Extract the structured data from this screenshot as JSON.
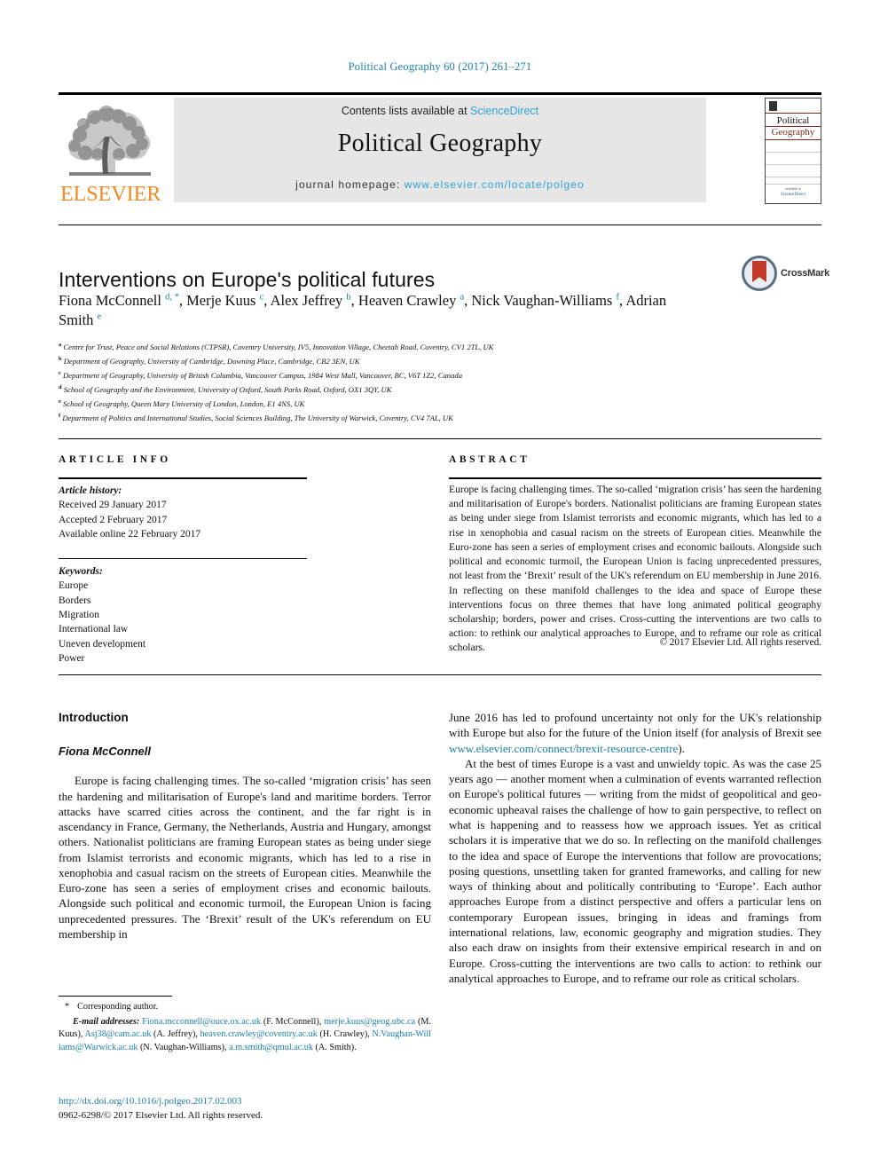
{
  "running_head": "Political Geography 60 (2017) 261–271",
  "masthead": {
    "contents_prefix": "Contents lists available at ",
    "sciencedirect": "ScienceDirect",
    "journal_title": "Political Geography",
    "homepage_label": "journal homepage: ",
    "homepage_url": "www.elsevier.com/locate/polgeo",
    "publisher_logo_text": "ELSEVIER",
    "cover": {
      "line1": "Political",
      "line2": "Geography",
      "footer_small": "available at",
      "footer_brand": "ScienceDirect"
    }
  },
  "crossmark": {
    "label": "CrossMark"
  },
  "article": {
    "title": "Interventions on Europe's political futures",
    "authors": [
      {
        "name": "Fiona McConnell",
        "marks": "d, *"
      },
      {
        "name": "Merje Kuus",
        "marks": "c"
      },
      {
        "name": "Alex Jeffrey",
        "marks": "b"
      },
      {
        "name": "Heaven Crawley",
        "marks": "a"
      },
      {
        "name": "Nick Vaughan-Williams",
        "marks": "f"
      },
      {
        "name": "Adrian Smith",
        "marks": "e"
      }
    ],
    "affiliations": [
      {
        "mark": "a",
        "text": "Centre for Trust, Peace and Social Relations (CTPSR), Coventry University, IV5, Innovation Village, Cheetah Road, Coventry, CV1 2TL, UK"
      },
      {
        "mark": "b",
        "text": "Department of Geography, University of Cambridge, Downing Place, Cambridge, CB2 3EN, UK"
      },
      {
        "mark": "c",
        "text": "Department of Geography, University of British Columbia, Vancouver Campus, 1984 West Mall, Vancouver, BC, V6T 1Z2, Canada"
      },
      {
        "mark": "d",
        "text": "School of Geography and the Environment, University of Oxford, South Parks Road, Oxford, OX1 3QY, UK"
      },
      {
        "mark": "e",
        "text": "School of Geography, Queen Mary University of London, London, E1 4NS, UK"
      },
      {
        "mark": "f",
        "text": "Department of Politics and International Studies, Social Sciences Building, The University of Warwick, Coventry, CV4 7AL, UK"
      }
    ]
  },
  "info": {
    "heading": "ARTICLE INFO",
    "history_label": "Article history:",
    "history": [
      "Received 29 January 2017",
      "Accepted 2 February 2017",
      "Available online 22 February 2017"
    ],
    "keywords_label": "Keywords:",
    "keywords": [
      "Europe",
      "Borders",
      "Migration",
      "International law",
      "Uneven development",
      "Power"
    ]
  },
  "abstract": {
    "heading": "ABSTRACT",
    "text": "Europe is facing challenging times. The so-called ‘migration crisis’ has seen the hardening and militarisation of Europe's borders. Nationalist politicians are framing European states as being under siege from Islamist terrorists and economic migrants, which has led to a rise in xenophobia and casual racism on the streets of European cities. Meanwhile the Euro-zone has seen a series of employment crises and economic bailouts. Alongside such political and economic turmoil, the European Union is facing unprecedented pressures, not least from the ‘Brexit’ result of the UK's referendum on EU membership in June 2016. In reflecting on these manifold challenges to the idea and space of Europe these interventions focus on three themes that have long animated political geography scholarship; borders, power and crises. Cross-cutting the interventions are two calls to action: to rethink our analytical approaches to Europe, and to reframe our role as critical scholars.",
    "copyright": "© 2017 Elsevier Ltd. All rights reserved."
  },
  "body": {
    "section_heading": "Introduction",
    "section_author": "Fiona McConnell",
    "left_paragraph": "Europe is facing challenging times. The so-called ‘migration crisis’ has seen the hardening and militarisation of Europe's land and maritime borders. Terror attacks have scarred cities across the continent, and the far right is in ascendancy in France, Germany, the Netherlands, Austria and Hungary, amongst others. Nationalist politicians are framing European states as being under siege from Islamist terrorists and economic migrants, which has led to a rise in xenophobia and casual racism on the streets of European cities. Meanwhile the Euro-zone has seen a series of employment crises and economic bailouts. Alongside such political and economic turmoil, the European Union is facing unprecedented pressures. The ‘Brexit’ result of the UK's referendum on EU membership in",
    "right_paragraph_1_before_link": "June 2016 has led to profound uncertainty not only for the UK's relationship with Europe but also for the future of the Union itself (for analysis of Brexit see ",
    "right_paragraph_1_link": "www.elsevier.com/connect/brexit-resource-centre",
    "right_paragraph_1_after_link": ").",
    "right_paragraph_2": "At the best of times Europe is a vast and unwieldy topic. As was the case 25 years ago — another moment when a culmination of events warranted reflection on Europe's political futures — writing from the midst of geopolitical and geo-economic upheaval raises the challenge of how to gain perspective, to reflect on what is happening and to reassess how we approach issues. Yet as critical scholars it is imperative that we do so. In reflecting on the manifold challenges to the idea and space of Europe the interventions that follow are provocations; posing questions, unsettling taken for granted frameworks, and calling for new ways of thinking about and politically contributing to ‘Europe’. Each author approaches Europe from a distinct perspective and offers a particular lens on contemporary European issues, bringing in ideas and framings from international relations, law, economic geography and migration studies. They also each draw on insights from their extensive empirical research in and on Europe. Cross-cutting the interventions are two calls to action: to rethink our analytical approaches to Europe, and to reframe our role as critical scholars."
  },
  "footnotes": {
    "corresponding": "Corresponding author.",
    "email_label": "E-mail addresses:",
    "emails": [
      {
        "address": "Fiona.mcconnell@ouce.ox.ac.uk",
        "person": "(F. McConnell)"
      },
      {
        "address": "merje.kuus@geog.ubc.ca",
        "person": "(M. Kuus)"
      },
      {
        "address": "Asj38@cam.ac.uk",
        "person": "(A. Jeffrey)"
      },
      {
        "address": "heaven.crawley@coventry.ac.uk",
        "person": "(H. Crawley)"
      },
      {
        "address": "N.Vaughan-Williams@Warwick.ac.uk",
        "person": "(N. Vaughan-Williams)"
      },
      {
        "address": "a.m.smith@qmul.ac.uk",
        "person": "(A. Smith)"
      }
    ]
  },
  "doi_block": {
    "doi": "http://dx.doi.org/10.1016/j.polgeo.2017.02.003",
    "issn_line": "0962-6298/© 2017 Elsevier Ltd. All rights reserved."
  }
}
